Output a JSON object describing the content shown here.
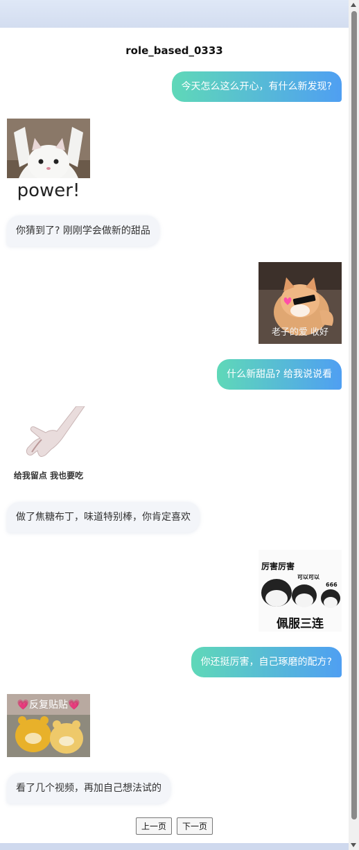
{
  "chat": {
    "title": "role_based_0333",
    "messages": [
      {
        "side": "out",
        "type": "text",
        "text": "今天怎么这么开心，有什么新发现?"
      },
      {
        "side": "in",
        "type": "sticker",
        "sticker": "cat-power",
        "caption": "power!"
      },
      {
        "side": "in",
        "type": "text",
        "text": "你猜到了? 刚刚学会做新的甜品"
      },
      {
        "side": "out",
        "type": "sticker",
        "sticker": "cat-sunglasses-heart",
        "caption": "老子的爱 收好"
      },
      {
        "side": "out",
        "type": "text",
        "text": "什么新甜品? 给我说说看"
      },
      {
        "side": "in",
        "type": "sticker",
        "sticker": "gloved-hand-reaching",
        "caption": "给我留点 我也要吃"
      },
      {
        "side": "in",
        "type": "text",
        "text": "做了焦糖布丁，味道特别棒，你肯定喜欢"
      },
      {
        "side": "out",
        "type": "sticker",
        "sticker": "three-mushroom-heads",
        "caption_top": "厉害厉害",
        "caption_mid": "可以可以",
        "caption_small": "666",
        "caption": "佩服三连"
      },
      {
        "side": "out",
        "type": "text",
        "text": "你还挺厉害，自己琢磨的配方?"
      },
      {
        "side": "in",
        "type": "sticker",
        "sticker": "yellow-bears-hug",
        "caption": "💗反复贴贴💗"
      },
      {
        "side": "in",
        "type": "text",
        "text": "看了几个视频，再加自己想法试的"
      }
    ]
  },
  "pager": {
    "prev": "上一页",
    "next": "下一页"
  }
}
